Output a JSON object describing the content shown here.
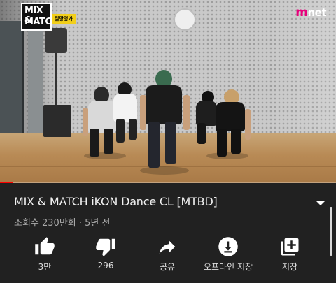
{
  "video": {
    "logo_line1": "MIX &",
    "logo_line2": "MATCH",
    "logo_tag": "절망명가",
    "channel_logo_m": "m",
    "channel_logo_rest": "net",
    "progress_fraction": 0.04,
    "progress_color": "#ff0000"
  },
  "info": {
    "title": "MIX & MATCH iKON Dance CL [MTBD]",
    "meta": "조회수 230만회 · 5년 전"
  },
  "actions": [
    {
      "icon": "thumb-up-icon",
      "label": "3만"
    },
    {
      "icon": "thumb-down-icon",
      "label": "296"
    },
    {
      "icon": "share-icon",
      "label": "공유"
    },
    {
      "icon": "download-icon",
      "label": "오프라인 저장"
    },
    {
      "icon": "save-playlist-icon",
      "label": "저장"
    }
  ]
}
